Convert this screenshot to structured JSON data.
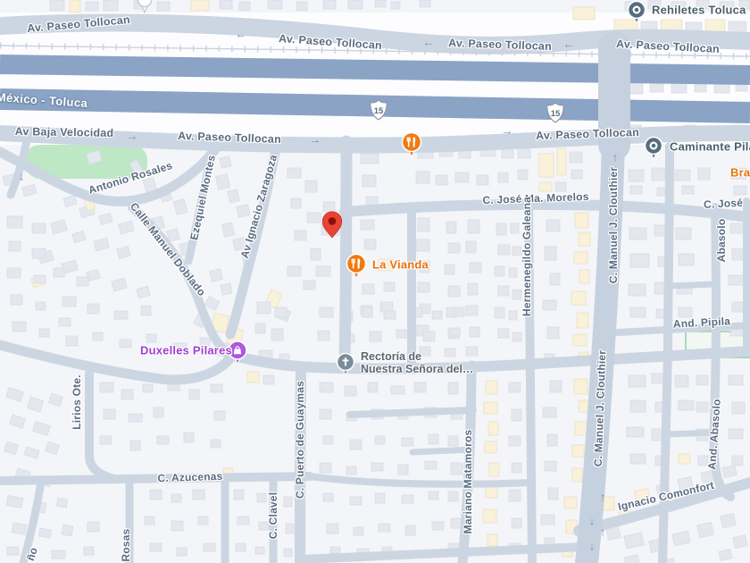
{
  "streets": {
    "tollocan": "Av. Paseo Tollocan",
    "mexico_toluca": "México - Toluca",
    "baja_velocidad": "Av Baja Velocidad",
    "morelos": "C. José Ma. Morelos",
    "jose_partial": "C. José",
    "antonio_rosales": "Antonio Rosales",
    "ezequiel_montes": "Ezequiel Montes",
    "zaragoza": "Av Ignacio Zaragoza",
    "manuel_doblado": "Calle Manuel Doblado",
    "galeana": "Hermenegildo Galeana",
    "clouthier": "C. Manuel J. Clouthier",
    "abasolo": "Abasolo",
    "and_pipila": "And. Pipila",
    "and_abasolo": "And. Abasolo",
    "lirios": "Lirios Ote.",
    "guaymas": "C. Puerto de Guaymas",
    "azucenas": "C. Azucenas",
    "clavel": "C. Clavel",
    "rosas": "Rosas",
    "matamoros": "Mariano Matamoros",
    "comonfort": "Ignacio Comonfort",
    "nio_partial": "ño"
  },
  "pois": {
    "rehiletes": "Rehiletes Toluca",
    "caminante": "Caminante Pila",
    "bras": "Bras",
    "la_vianda": "La Vianda",
    "duxelles": "Duxelles Pilares",
    "rectoria_line1": "Rectoría de",
    "rectoria_line2": "Nuestra Señora del…"
  },
  "shield": {
    "route": "15"
  },
  "icons": {
    "arrow_left": "←",
    "arrow_right": "→",
    "arrow_up": "↑",
    "arrow_down": "↓",
    "restaurant_pin": "fork-knife",
    "shopping_pin": "shopping-bag",
    "church_pin": "cross",
    "generic_pin": "ring-dot",
    "place_marker": "red-pin"
  },
  "colors": {
    "road": "#ccd6e2",
    "highway": "#8ba3c5",
    "park": "#bee7c6",
    "building": "#e4e7ee",
    "building_accent": "#faf1da",
    "poi_orange": "#e8710a",
    "poi_purple": "#a13dd1",
    "poi_slate": "#546e7d",
    "marker_red": "#ea4335",
    "label": "#5b6b81"
  }
}
